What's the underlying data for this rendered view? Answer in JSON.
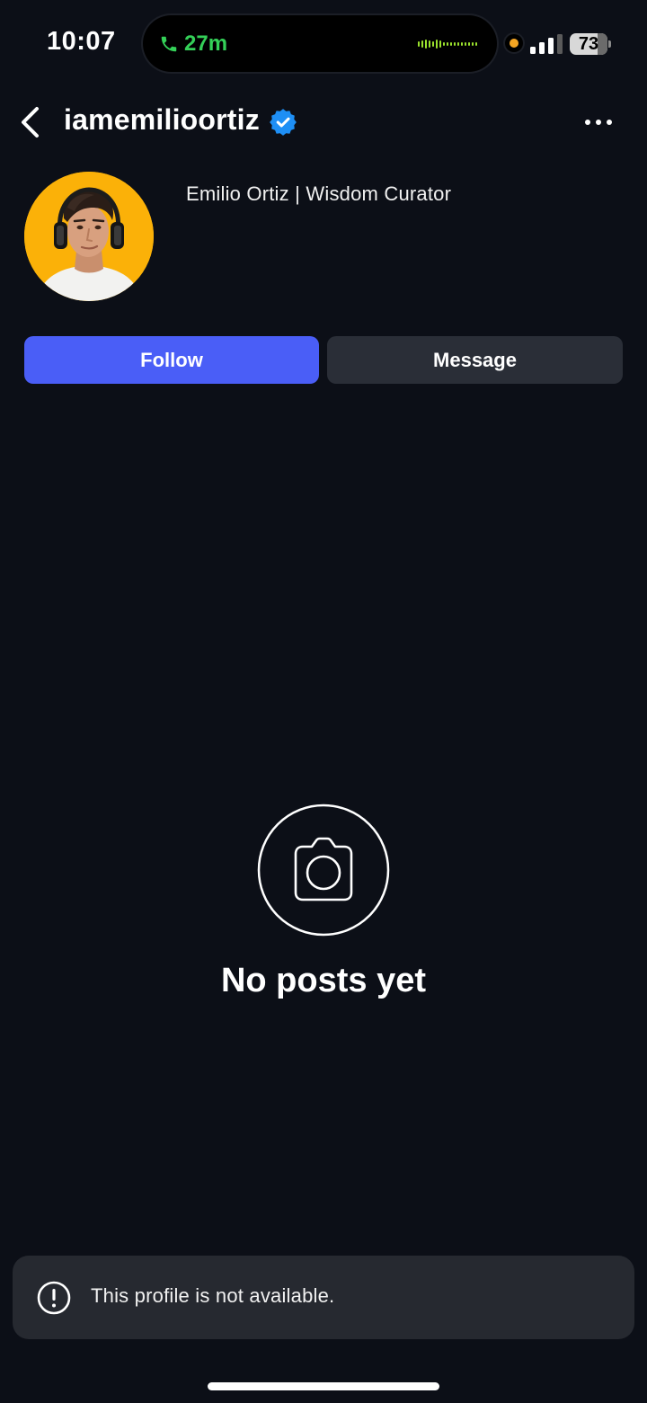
{
  "status_bar": {
    "time": "10:07",
    "call_duration": "27m",
    "battery_percent": "73",
    "battery_level": 0.73,
    "signal_bars": 3,
    "call_color": "#34d058",
    "recording_dot_color": "#f5a623"
  },
  "header": {
    "username": "iamemilioortiz",
    "verified": true,
    "verified_color": "#1e8ff5",
    "back_icon": "chevron-left-icon",
    "more_icon": "ellipsis-horizontal-icon"
  },
  "profile": {
    "display_name": "Emilio Ortiz | Wisdom Curator",
    "avatar_background": "#fbb108"
  },
  "actions": {
    "follow_label": "Follow",
    "message_label": "Message",
    "follow_color": "#4a5ef7"
  },
  "empty_state": {
    "icon": "camera-icon",
    "title": "No posts yet"
  },
  "toast": {
    "icon": "exclamation-circle-icon",
    "message": "This profile is not available."
  }
}
